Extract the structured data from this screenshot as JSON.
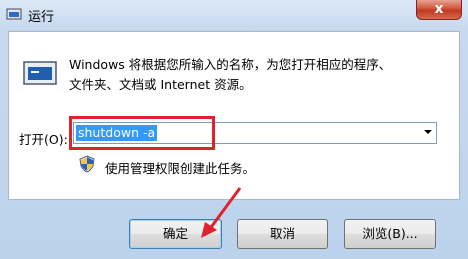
{
  "window": {
    "title": "运行"
  },
  "titlebar": {
    "close_label": "x"
  },
  "description": {
    "line1": "Windows 将根据您所输入的名称，为您打开相应的程序、",
    "line2": "文件夹、文档或 Internet 资源。"
  },
  "open": {
    "label": "打开(O):",
    "value": "shutdown -a"
  },
  "admin_note": "使用管理权限创建此任务。",
  "buttons": {
    "ok": "确定",
    "cancel": "取消",
    "browse": "浏览(B)..."
  },
  "colors": {
    "highlight": "#e0212e",
    "selection": "#3399ff"
  },
  "icons": {
    "app": "run-app-icon",
    "big": "run-dialog-icon",
    "shield": "uac-shield-icon"
  }
}
